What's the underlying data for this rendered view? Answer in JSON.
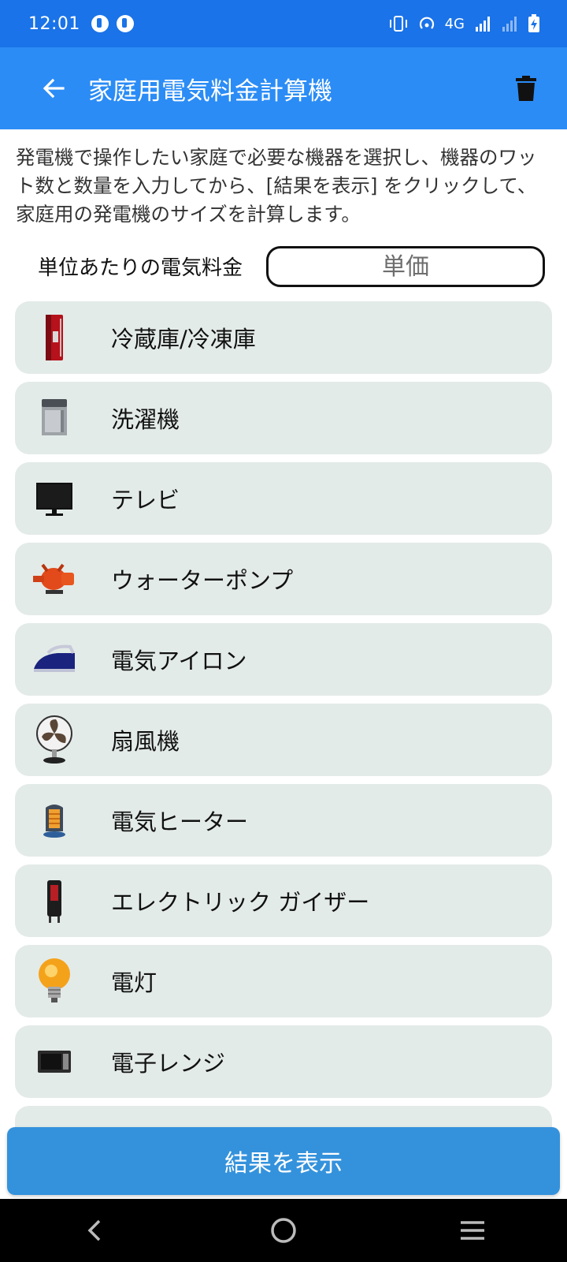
{
  "status_bar": {
    "time": "12:01",
    "network": "4G"
  },
  "app_bar": {
    "title": "家庭用電気料金計算機"
  },
  "description": "発電機で操作したい家庭で必要な機器を選択し、機器のワット数と数量を入力してから、[結果を表示] をクリックして、家庭用の発電機のサイズを計算します。",
  "rate": {
    "label": "単位あたりの電気料金",
    "placeholder": "単価"
  },
  "appliances": [
    {
      "label": "冷蔵庫/冷凍庫",
      "icon": "refrigerator-icon"
    },
    {
      "label": "洗濯機",
      "icon": "washing-machine-icon"
    },
    {
      "label": "テレビ",
      "icon": "tv-icon"
    },
    {
      "label": "ウォーターポンプ",
      "icon": "water-pump-icon"
    },
    {
      "label": "電気アイロン",
      "icon": "iron-icon"
    },
    {
      "label": "扇風機",
      "icon": "fan-icon"
    },
    {
      "label": "電気ヒーター",
      "icon": "heater-icon"
    },
    {
      "label": "エレクトリック ガイザー",
      "icon": "geyser-icon"
    },
    {
      "label": "電灯",
      "icon": "light-bulb-icon"
    },
    {
      "label": "電子レンジ",
      "icon": "microwave-icon"
    }
  ],
  "result_button": "結果を表示",
  "colors": {
    "status_bar": "#1a73e8",
    "app_bar": "#2b8cf5",
    "list_item_bg": "#e3ebe8",
    "result_button": "#3492dc"
  }
}
